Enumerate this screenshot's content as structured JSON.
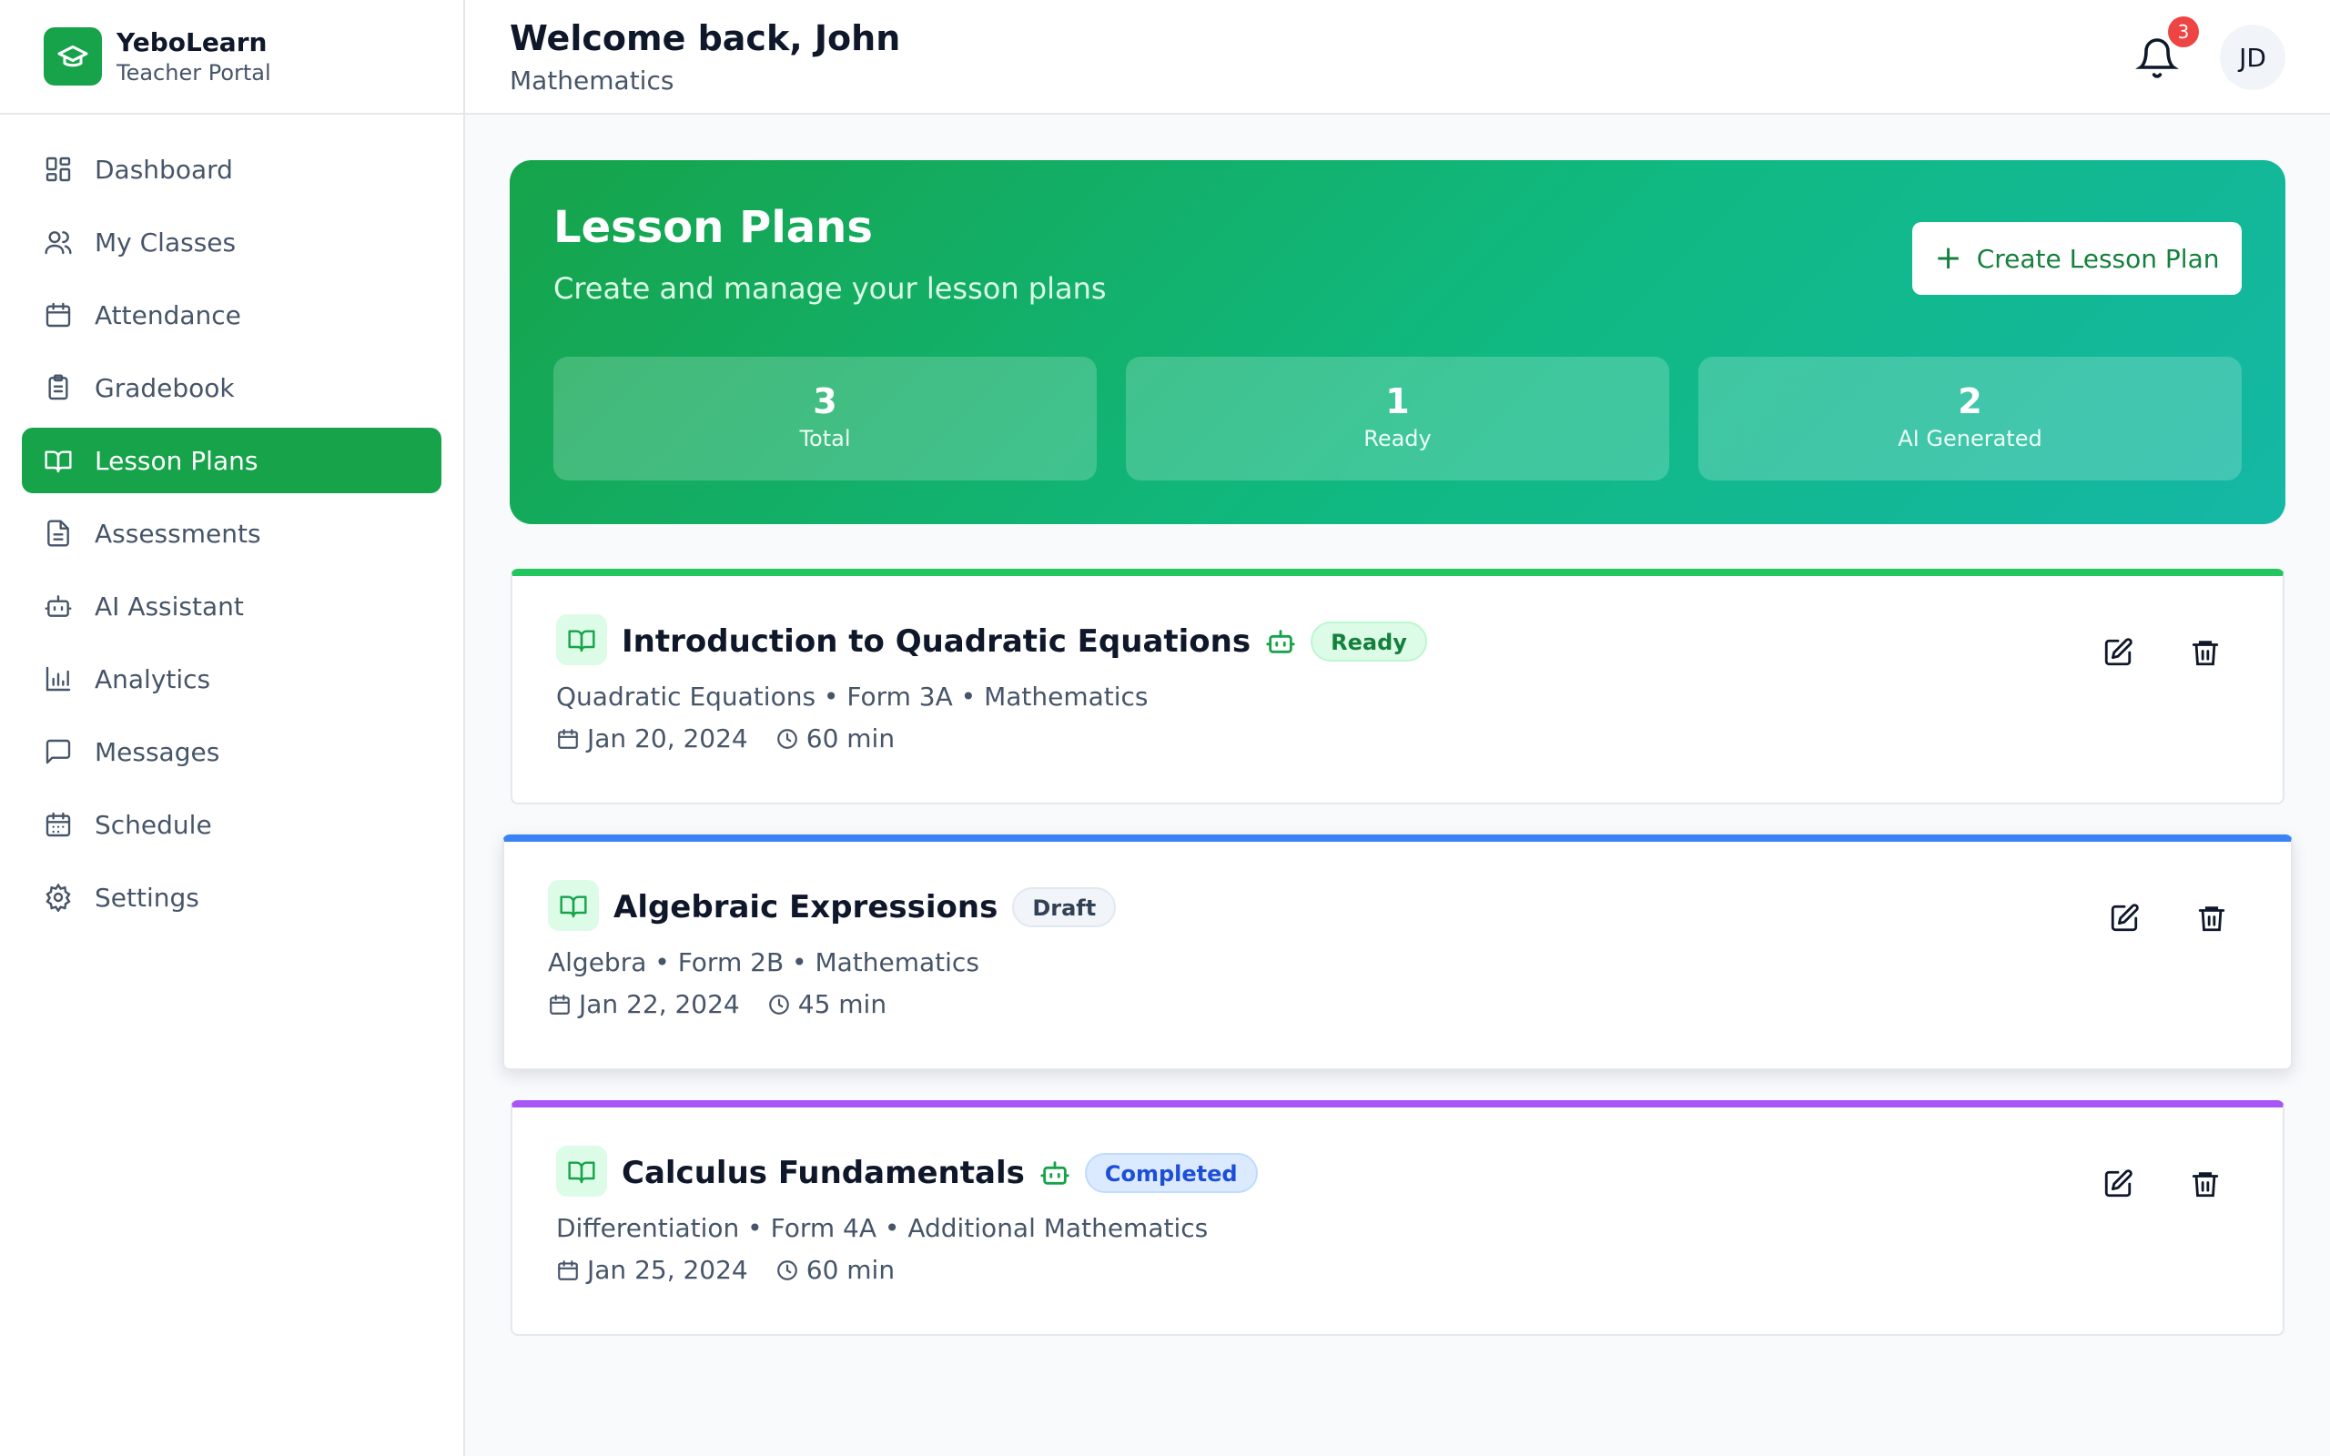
{
  "brand": {
    "name": "YeboLearn",
    "subtitle": "Teacher Portal"
  },
  "sidebar": {
    "items": [
      {
        "label": "Dashboard",
        "icon": "dashboard-icon"
      },
      {
        "label": "My Classes",
        "icon": "users-icon"
      },
      {
        "label": "Attendance",
        "icon": "calendar-icon"
      },
      {
        "label": "Gradebook",
        "icon": "clipboard-icon"
      },
      {
        "label": "Lesson Plans",
        "icon": "book-icon",
        "active": true
      },
      {
        "label": "Assessments",
        "icon": "document-icon"
      },
      {
        "label": "AI Assistant",
        "icon": "bot-icon"
      },
      {
        "label": "Analytics",
        "icon": "bar-chart-icon"
      },
      {
        "label": "Messages",
        "icon": "message-icon"
      },
      {
        "label": "Schedule",
        "icon": "schedule-icon"
      },
      {
        "label": "Settings",
        "icon": "gear-icon"
      }
    ]
  },
  "header": {
    "title": "Welcome back, John",
    "subtitle": "Mathematics",
    "notification_count": "3",
    "avatar_initials": "JD"
  },
  "banner": {
    "title": "Lesson Plans",
    "subtitle": "Create and manage your lesson plans",
    "create_label": "Create Lesson Plan",
    "stats": [
      {
        "value": "3",
        "label": "Total"
      },
      {
        "value": "1",
        "label": "Ready"
      },
      {
        "value": "2",
        "label": "AI Generated"
      }
    ]
  },
  "lessons": [
    {
      "title": "Introduction to Quadratic Equations",
      "ai_generated": true,
      "status": "Ready",
      "meta": "Quadratic Equations • Form 3A • Mathematics",
      "date": "Jan 20, 2024",
      "duration": "60 min",
      "accent": "#22c55e"
    },
    {
      "title": "Algebraic Expressions",
      "ai_generated": false,
      "status": "Draft",
      "meta": "Algebra • Form 2B • Mathematics",
      "date": "Jan 22, 2024",
      "duration": "45 min",
      "accent": "#3b82f6"
    },
    {
      "title": "Calculus Fundamentals",
      "ai_generated": true,
      "status": "Completed",
      "meta": "Differentiation • Form 4A • Additional Mathematics",
      "date": "Jan 25, 2024",
      "duration": "60 min",
      "accent": "#a855f7"
    }
  ],
  "colors": {
    "brand": "#16a34a",
    "ready": "#22c55e",
    "draft": "#3b82f6",
    "completed": "#a855f7",
    "notification": "#ef4444"
  }
}
